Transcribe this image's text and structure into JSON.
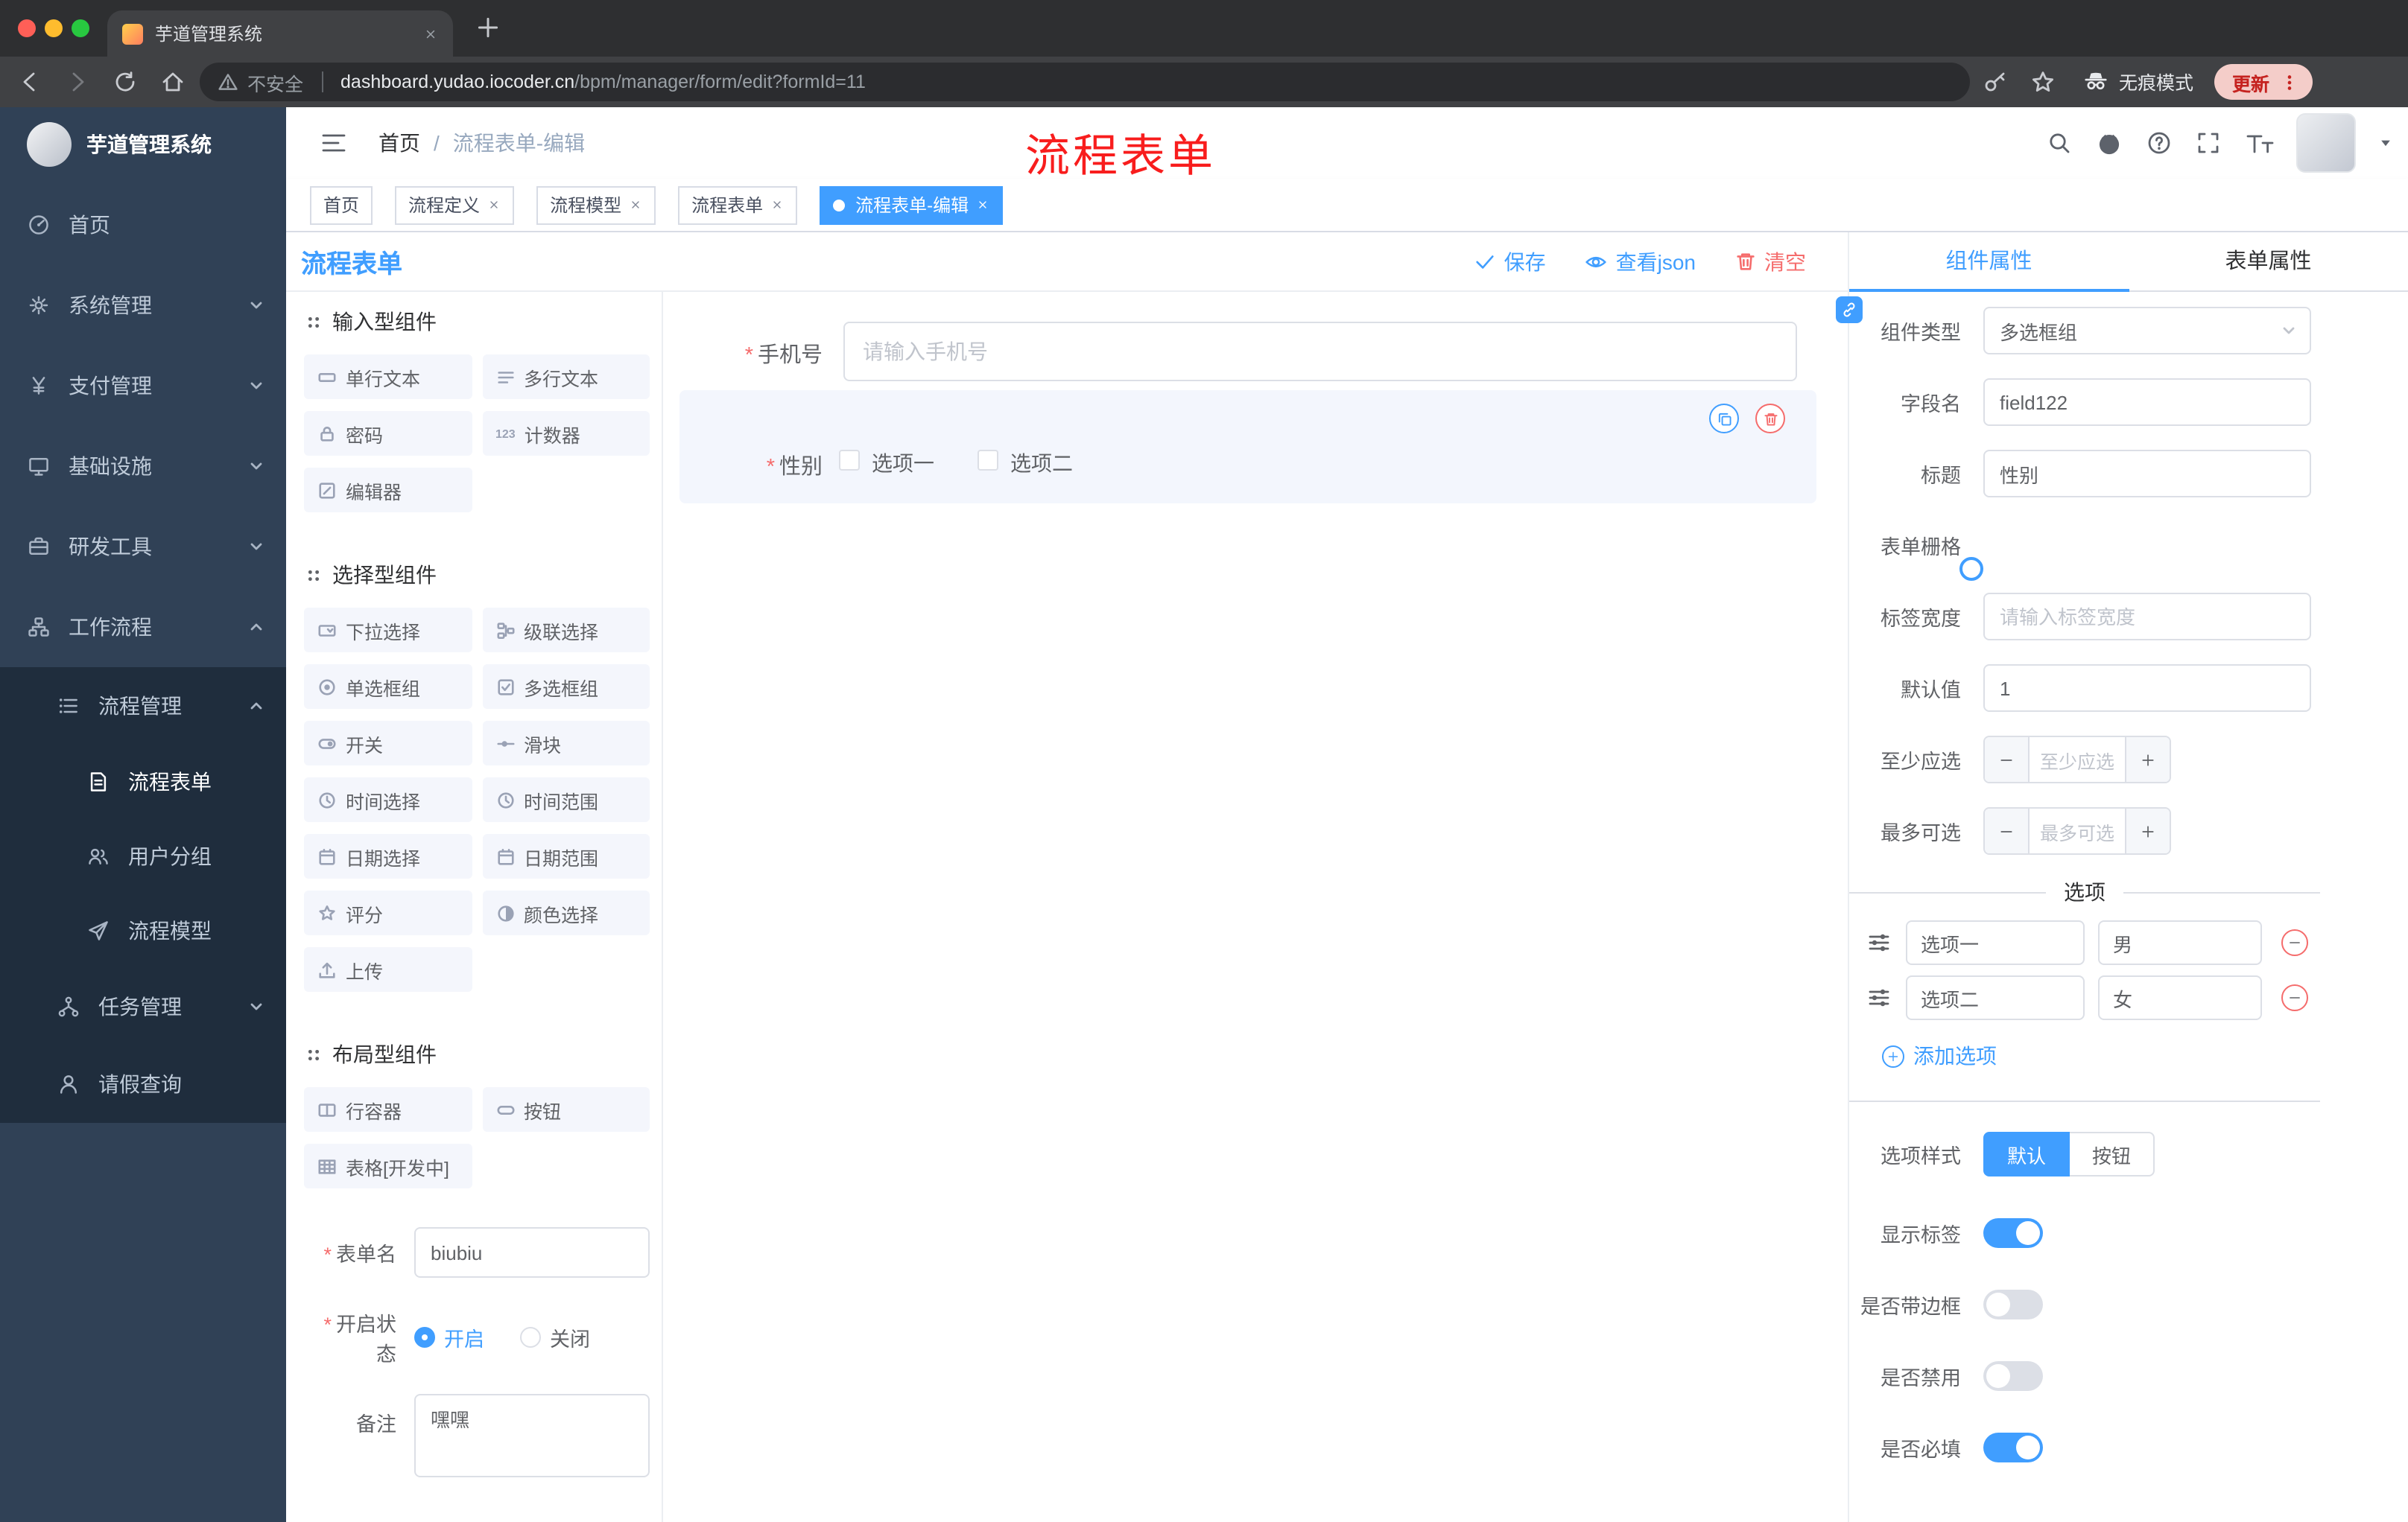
{
  "colors": {
    "accent": "#409EFF",
    "danger": "#F56C6C",
    "sidebar_bg": "#304156",
    "submenu_bg": "#1f2d3d"
  },
  "browser": {
    "tab_title": "芋道管理系统",
    "security_label": "不安全",
    "url_domain": "dashboard.yudao.iocoder.cn",
    "url_path": "/bpm/manager/form/edit?formId=11",
    "incognito_label": "无痕模式",
    "update_label": "更新"
  },
  "sidebar": {
    "logo_title": "芋道管理系统",
    "items": [
      {
        "label": "首页",
        "icon": "dashboard-icon"
      },
      {
        "label": "系统管理",
        "icon": "gear-icon"
      },
      {
        "label": "支付管理",
        "icon": "yen-icon"
      },
      {
        "label": "基础设施",
        "icon": "monitor-icon"
      },
      {
        "label": "研发工具",
        "icon": "briefcase-icon"
      },
      {
        "label": "工作流程",
        "icon": "workflow-icon"
      },
      {
        "label": "流程管理",
        "icon": "list-icon"
      },
      {
        "label": "流程表单",
        "icon": "document-icon",
        "active": true
      },
      {
        "label": "用户分组",
        "icon": "users-icon"
      },
      {
        "label": "流程模型",
        "icon": "paper-plane-icon"
      },
      {
        "label": "任务管理",
        "icon": "tree-icon"
      },
      {
        "label": "请假查询",
        "icon": "person-icon"
      }
    ]
  },
  "header": {
    "breadcrumb": [
      "首页",
      "流程表单-编辑"
    ],
    "annotation": "流程表单"
  },
  "tags": [
    {
      "label": "首页",
      "closable": false,
      "active": false
    },
    {
      "label": "流程定义",
      "closable": true,
      "active": false
    },
    {
      "label": "流程模型",
      "closable": true,
      "active": false
    },
    {
      "label": "流程表单",
      "closable": true,
      "active": false
    },
    {
      "label": "流程表单-编辑",
      "closable": true,
      "active": true
    }
  ],
  "designer": {
    "title": "流程表单",
    "save_label": "保存",
    "view_json_label": "查看json",
    "clear_label": "清空"
  },
  "palette": {
    "counter_icon_text": "123",
    "sections": [
      {
        "title": "输入型组件",
        "items": [
          {
            "label": "单行文本",
            "icon": "single-line-text-icon"
          },
          {
            "label": "多行文本",
            "icon": "multi-line-text-icon"
          },
          {
            "label": "密码",
            "icon": "lock-icon"
          },
          {
            "label": "计数器",
            "icon": "counter-123-icon"
          },
          {
            "label": "编辑器",
            "icon": "editor-icon"
          }
        ]
      },
      {
        "title": "选择型组件",
        "items": [
          {
            "label": "下拉选择",
            "icon": "select-icon"
          },
          {
            "label": "级联选择",
            "icon": "cascade-icon"
          },
          {
            "label": "单选框组",
            "icon": "radio-icon"
          },
          {
            "label": "多选框组",
            "icon": "checkbox-icon"
          },
          {
            "label": "开关",
            "icon": "switch-icon"
          },
          {
            "label": "滑块",
            "icon": "slider-icon"
          },
          {
            "label": "时间选择",
            "icon": "clock-icon"
          },
          {
            "label": "时间范围",
            "icon": "clock-range-icon"
          },
          {
            "label": "日期选择",
            "icon": "calendar-icon"
          },
          {
            "label": "日期范围",
            "icon": "calendar-range-icon"
          },
          {
            "label": "评分",
            "icon": "star-icon"
          },
          {
            "label": "颜色选择",
            "icon": "color-icon"
          },
          {
            "label": "上传",
            "icon": "upload-icon"
          }
        ]
      },
      {
        "title": "布局型组件",
        "items": [
          {
            "label": "行容器",
            "icon": "row-container-icon"
          },
          {
            "label": "按钮",
            "icon": "button-icon"
          },
          {
            "label": "表格[开发中]",
            "icon": "table-icon"
          }
        ]
      }
    ],
    "form_name_label": "表单名",
    "form_name_value": "biubiu",
    "status_label": "开启状态",
    "status_options": [
      "开启",
      "关闭"
    ],
    "status_selected": "开启",
    "remark_label": "备注",
    "remark_value": "嘿嘿"
  },
  "canvas": {
    "phone_label": "手机号",
    "phone_placeholder": "请输入手机号",
    "gender_label": "性别",
    "gender_options": [
      "选项一",
      "选项二"
    ]
  },
  "panel": {
    "tabs": [
      "组件属性",
      "表单属性"
    ],
    "component_type_label": "组件类型",
    "component_type_value": "多选框组",
    "field_name_label": "字段名",
    "field_name_value": "field122",
    "title_label": "标题",
    "title_value": "性别",
    "grid_label": "表单栅格",
    "label_width_label": "标签宽度",
    "label_width_placeholder": "请输入标签宽度",
    "default_label": "默认值",
    "default_value": "1",
    "min_label": "至少应选",
    "min_placeholder": "至少应选",
    "max_label": "最多可选",
    "max_placeholder": "最多可选",
    "options_title": "选项",
    "options": [
      {
        "name": "选项一",
        "value": "男"
      },
      {
        "name": "选项二",
        "value": "女"
      }
    ],
    "add_option_label": "添加选项",
    "option_style_label": "选项样式",
    "option_style_choices": [
      "默认",
      "按钮"
    ],
    "option_style_selected": "默认",
    "switches": [
      {
        "label": "显示标签",
        "on": true
      },
      {
        "label": "是否带边框",
        "on": false
      },
      {
        "label": "是否禁用",
        "on": false
      },
      {
        "label": "是否必填",
        "on": true
      }
    ]
  }
}
